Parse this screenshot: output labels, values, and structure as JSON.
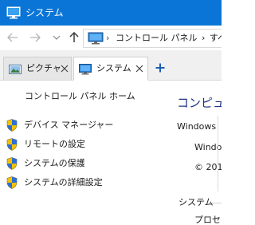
{
  "titlebar": {
    "title": "システム",
    "icon": "system-monitor-icon",
    "color": "#0a75d6"
  },
  "navbar": {
    "back_icon": "arrow-left-icon",
    "forward_icon": "arrow-right-icon",
    "recent_icon": "chevron-down-icon",
    "up_icon": "arrow-up-icon",
    "address_icon": "control-panel-icon",
    "address_separator": "›",
    "breadcrumbs": [
      "コントロール パネル",
      "›",
      "すべ"
    ]
  },
  "tabs": [
    {
      "label": "ピクチャ",
      "icon": "picture-icon",
      "active": false
    },
    {
      "label": "システム",
      "icon": "system-monitor-icon",
      "active": true
    }
  ],
  "new_tab_icon": "plus-icon",
  "sidebar": {
    "home_label": "コントロール パネル ホーム",
    "tasks": [
      {
        "label": "デバイス マネージャー",
        "icon": "uac-shield-icon"
      },
      {
        "label": "リモートの設定",
        "icon": "uac-shield-icon"
      },
      {
        "label": "システムの保護",
        "icon": "uac-shield-icon"
      },
      {
        "label": "システムの詳細設定",
        "icon": "uac-shield-icon"
      }
    ]
  },
  "main": {
    "heading": "コンピュー",
    "windows_edition_label": "Windows",
    "windows_line2": "Windo",
    "copyright": "© 201",
    "system_label": "システム",
    "processor_label": "プロセ"
  }
}
